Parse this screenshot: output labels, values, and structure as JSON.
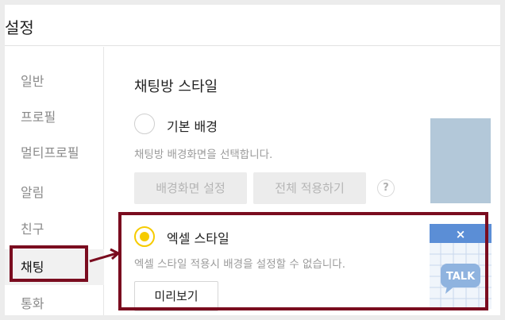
{
  "window": {
    "title": "설정"
  },
  "sidebar": {
    "items": [
      {
        "label": "일반"
      },
      {
        "label": "프로필"
      },
      {
        "label": "멀티프로필"
      },
      {
        "label": "알림"
      },
      {
        "label": "친구"
      },
      {
        "label": "채팅"
      },
      {
        "label": "통화"
      }
    ],
    "active": "채팅"
  },
  "content": {
    "section_title": "채팅방 스타일",
    "options": [
      {
        "label": "기본 배경",
        "description": "채팅방 배경화면을 선택합니다.",
        "selected": false,
        "buttons": [
          "배경화면 설정",
          "전체 적용하기"
        ],
        "help": "?"
      },
      {
        "label": "엑셀 스타일",
        "description": "엑셀 스타일 적용시 배경을 설정할 수 없습니다.",
        "selected": true,
        "preview_button": "미리보기",
        "thumbnail_text": "TALK"
      }
    ]
  },
  "colors": {
    "accent": "#f6cb00",
    "highlight": "#7a0c1f",
    "thumb_blue": "#b3c8d9",
    "excel_blue": "#5b8ed6"
  }
}
